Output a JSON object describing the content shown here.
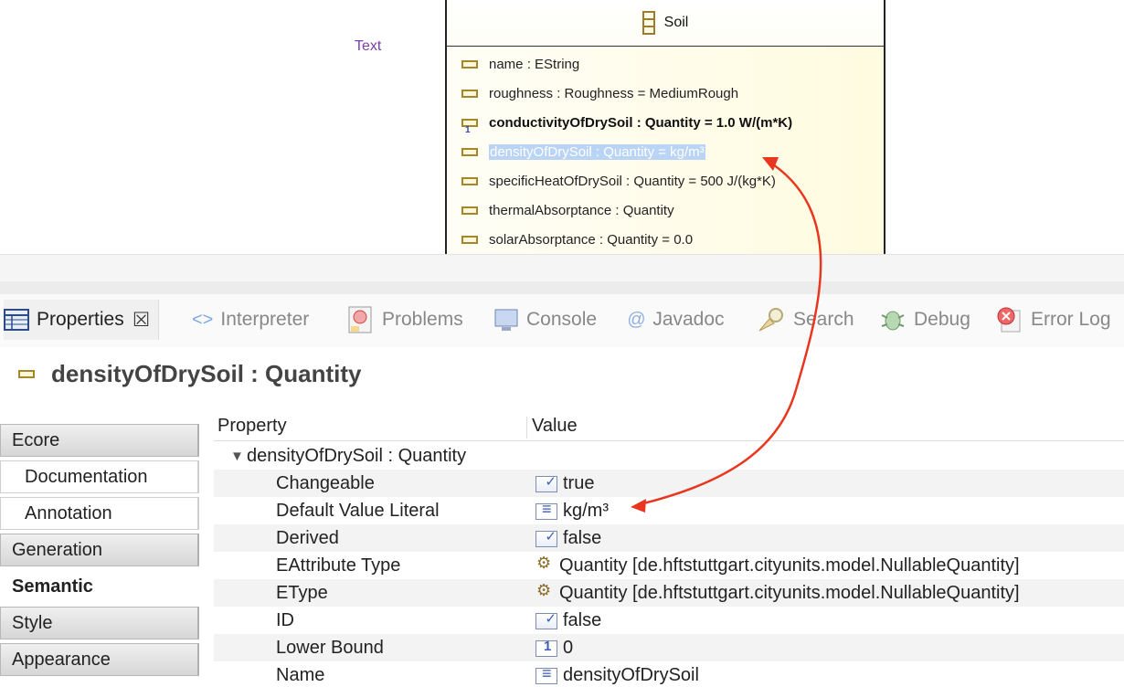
{
  "diagram": {
    "class_name": "Soil",
    "attributes": [
      {
        "text": "name : EString",
        "bold": false,
        "selected": false,
        "multiplicity": ""
      },
      {
        "text": "roughness : Roughness = MediumRough",
        "bold": false,
        "selected": false,
        "multiplicity": ""
      },
      {
        "text": "conductivityOfDrySoil : Quantity = 1.0 W/(m*K)",
        "bold": true,
        "selected": false,
        "multiplicity": "1"
      },
      {
        "text": "densityOfDrySoil : Quantity = kg/m³",
        "bold": false,
        "selected": true,
        "multiplicity": ""
      },
      {
        "text": "specificHeatOfDrySoil : Quantity = 500 J/(kg*K)",
        "bold": false,
        "selected": false,
        "multiplicity": ""
      },
      {
        "text": "thermalAbsorptance : Quantity",
        "bold": false,
        "selected": false,
        "multiplicity": ""
      },
      {
        "text": "solarAbsorptance : Quantity = 0.0",
        "bold": false,
        "selected": false,
        "multiplicity": ""
      }
    ]
  },
  "tabs": [
    {
      "label": "Properties",
      "icon": "properties-icon",
      "active": true
    },
    {
      "label": "Interpreter",
      "icon": "interpreter-icon",
      "active": false,
      "sublabel": "Text"
    },
    {
      "label": "Problems",
      "icon": "problems-icon",
      "active": false
    },
    {
      "label": "Console",
      "icon": "console-icon",
      "active": false
    },
    {
      "label": "Javadoc",
      "icon": "javadoc-icon",
      "active": false
    },
    {
      "label": "Search",
      "icon": "search-icon",
      "active": false
    },
    {
      "label": "Debug",
      "icon": "debug-icon",
      "active": false
    },
    {
      "label": "Error Log",
      "icon": "error-log-icon",
      "active": false
    }
  ],
  "properties": {
    "title": "densityOfDrySoil : Quantity",
    "categories": [
      {
        "label": "Ecore",
        "sub": false,
        "active": false
      },
      {
        "label": "Documentation",
        "sub": true,
        "active": false
      },
      {
        "label": "Annotation",
        "sub": true,
        "active": false
      },
      {
        "label": "Generation",
        "sub": false,
        "active": false
      },
      {
        "label": "Semantic",
        "sub": false,
        "active": true
      },
      {
        "label": "Style",
        "sub": false,
        "active": false
      },
      {
        "label": "Appearance",
        "sub": false,
        "active": false
      }
    ],
    "table": {
      "col_property": "Property",
      "col_value": "Value",
      "group_label": "densityOfDrySoil : Quantity",
      "rows": [
        {
          "name": "Changeable",
          "value": "true",
          "icon": "boolean-icon"
        },
        {
          "name": "Default Value Literal",
          "value": "kg/m³",
          "icon": "text-icon"
        },
        {
          "name": "Derived",
          "value": "false",
          "icon": "boolean-icon"
        },
        {
          "name": "EAttribute Type",
          "value": "Quantity [de.hftstuttgart.cityunits.model.NullableQuantity]",
          "icon": "type-icon"
        },
        {
          "name": "EType",
          "value": "Quantity [de.hftstuttgart.cityunits.model.NullableQuantity]",
          "icon": "type-icon"
        },
        {
          "name": "ID",
          "value": "false",
          "icon": "boolean-icon"
        },
        {
          "name": "Lower Bound",
          "value": "0",
          "icon": "number-icon"
        },
        {
          "name": "Name",
          "value": "densityOfDrySoil",
          "icon": "text-icon"
        }
      ]
    }
  },
  "colors": {
    "arrow": "#e8371e",
    "selection": "#b9d4f5",
    "attribute_icon": "#a6862c"
  }
}
